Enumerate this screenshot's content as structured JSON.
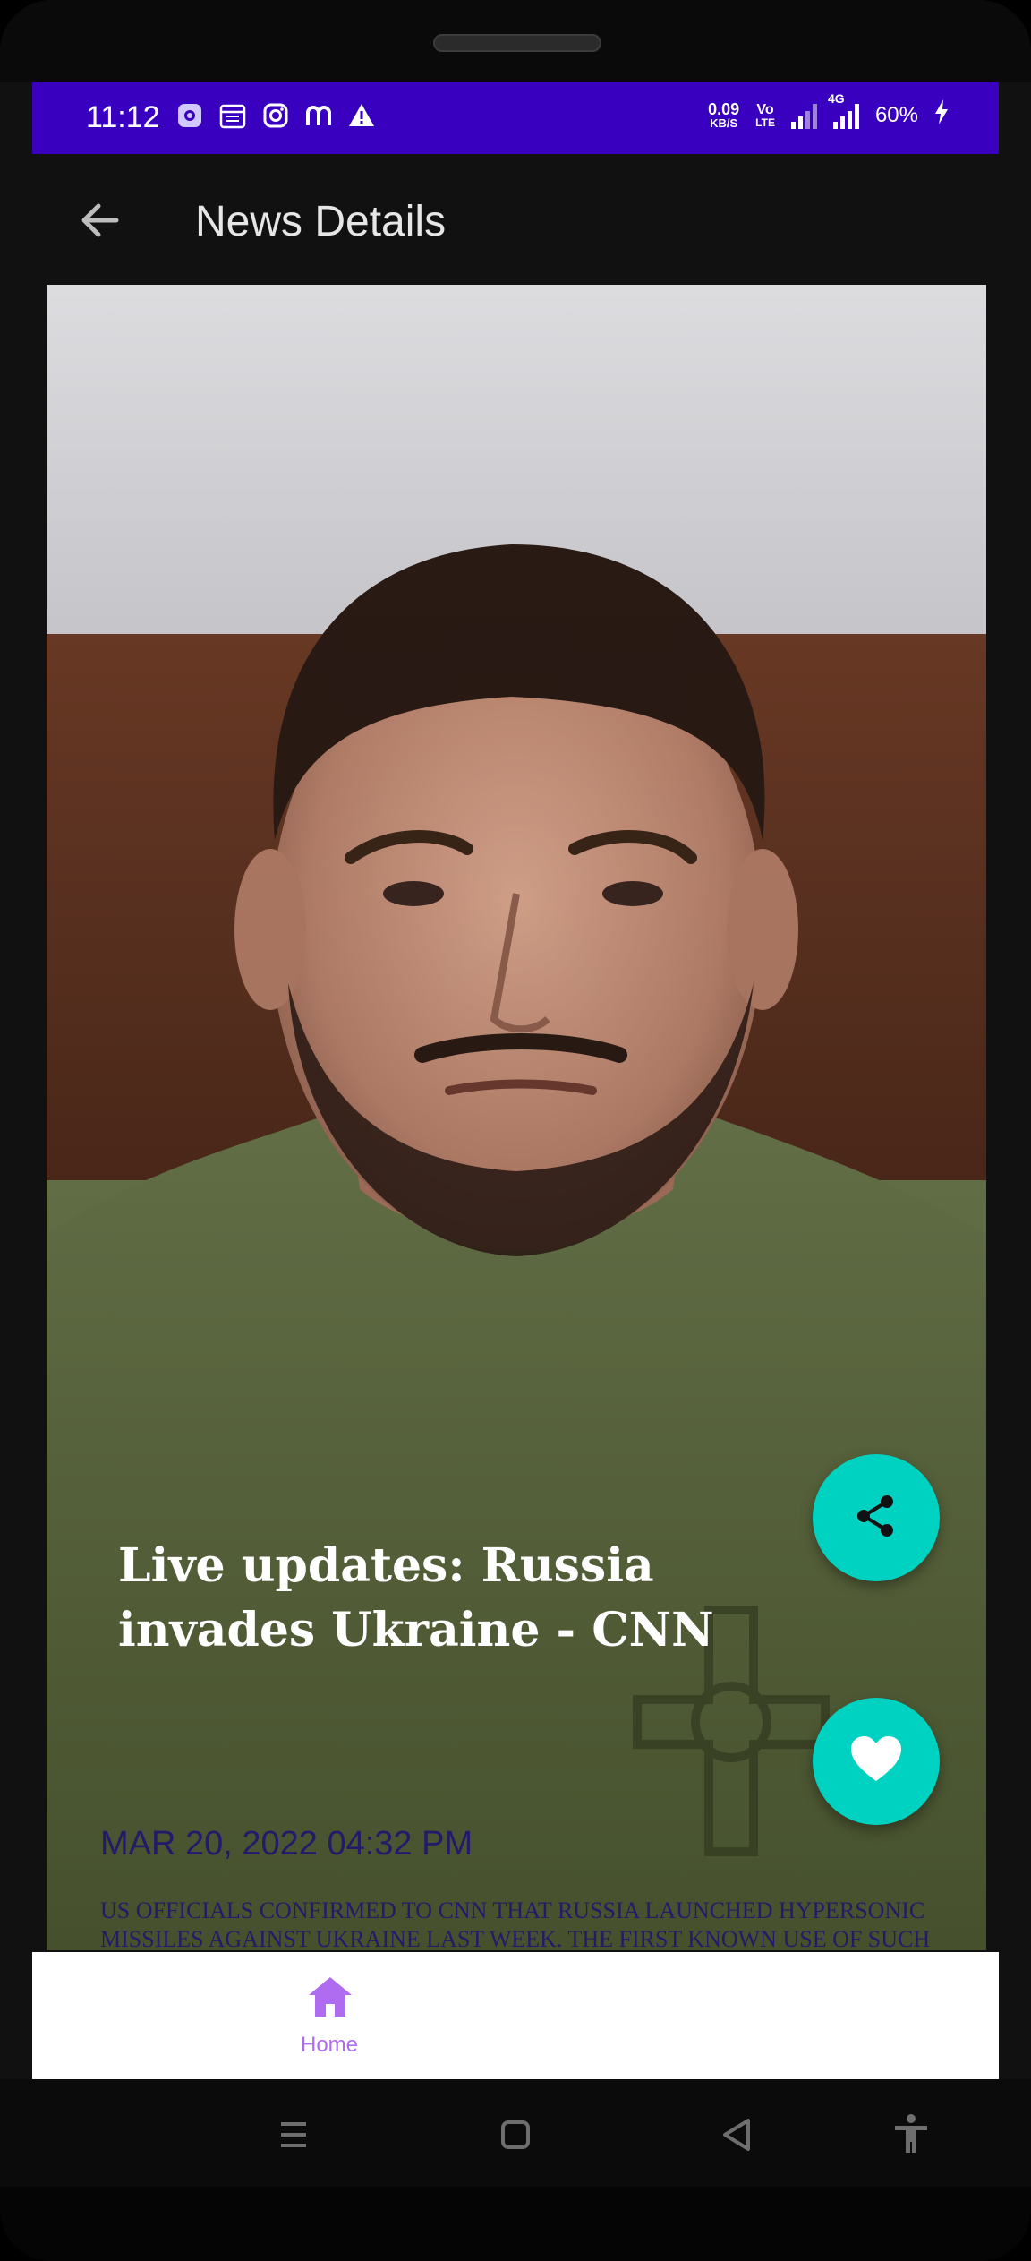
{
  "status_bar": {
    "time": "11:12",
    "net_speed_value": "0.09",
    "net_speed_unit": "KB/S",
    "volte_top": "Vo",
    "volte_bottom": "LTE",
    "network_label": "4G",
    "battery": "60%",
    "icons": [
      "settings-icon",
      "calendar-icon",
      "instagram-icon",
      "m-app-icon",
      "warning-icon"
    ]
  },
  "app_bar": {
    "title": "News Details",
    "back_icon": "arrow-left-icon"
  },
  "article": {
    "headline": "Live updates: Russia invades Ukraine - CNN",
    "date": "MAR 20, 2022 04:32 PM",
    "description": "US OFFICIALS CONFIRMED TO CNN THAT RUSSIA LAUNCHED HYPERSONIC MISSILES AGAINST UKRAINE LAST WEEK. THE FIRST KNOWN USE OF SUCH"
  },
  "fabs": {
    "share_icon": "share-icon",
    "like_icon": "heart-icon",
    "color": "#00d2c2"
  },
  "bottom_nav": {
    "home_label": "Home",
    "home_icon": "home-icon",
    "accent": "#b06cf0"
  },
  "system_nav": {
    "icons": [
      "recents-icon",
      "home-square-icon",
      "back-triangle-icon",
      "accessibility-icon"
    ]
  },
  "colors": {
    "status_bar": "#3a00c0",
    "app_bar": "#111111",
    "text_dark_blue": "#231a6a"
  }
}
